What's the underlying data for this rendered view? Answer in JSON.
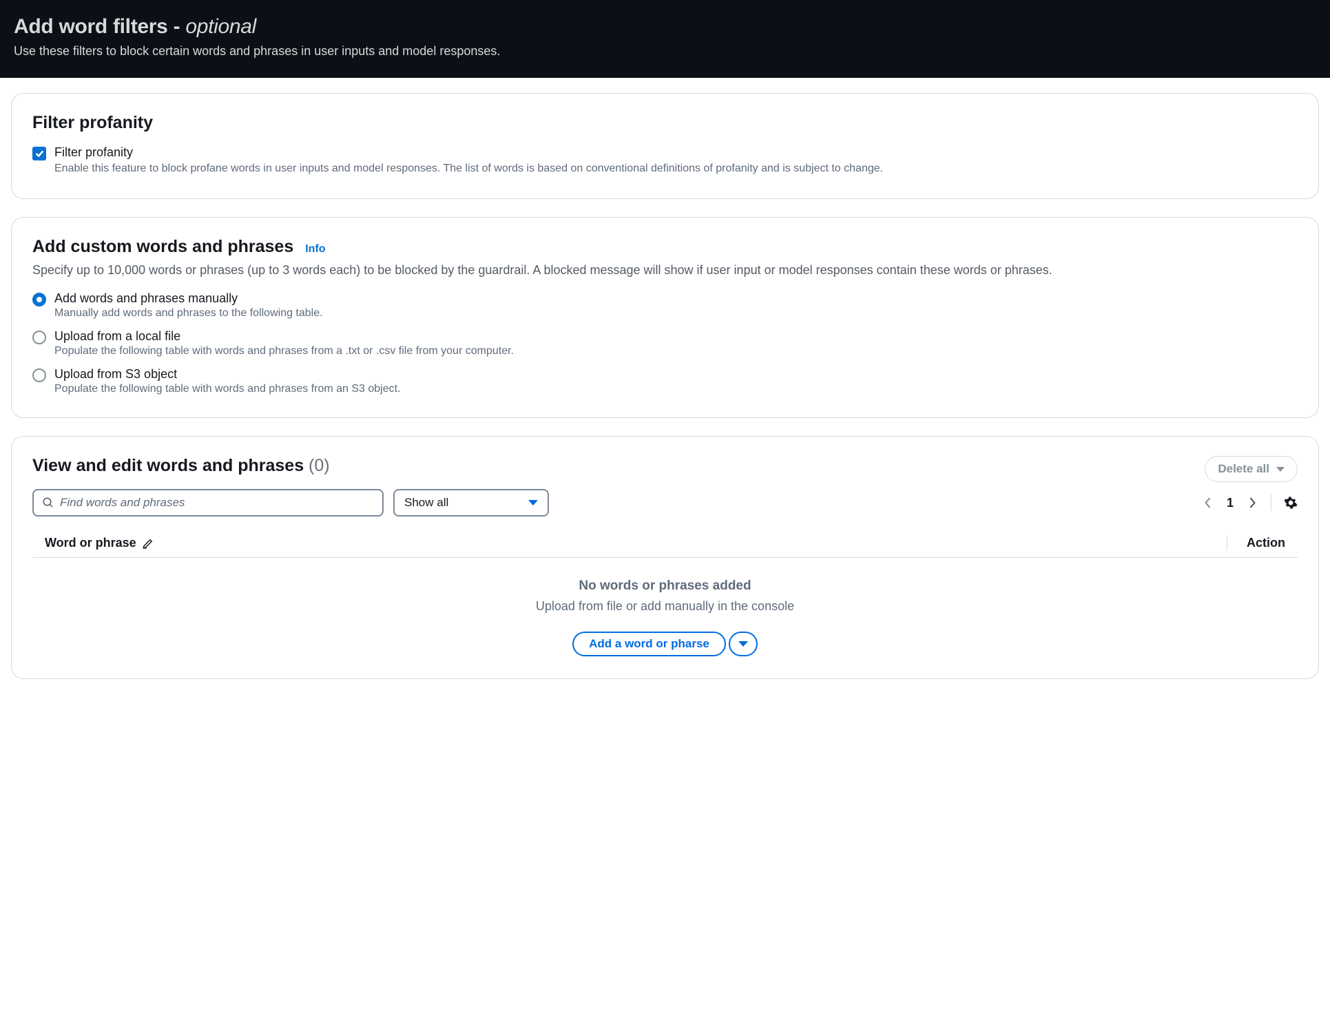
{
  "header": {
    "title_main": "Add word filters -",
    "title_optional": "optional",
    "desc": "Use these filters to block certain words and phrases in user inputs and model responses."
  },
  "profanity": {
    "section_title": "Filter profanity",
    "check_label": "Filter profanity",
    "check_desc": "Enable this feature to block profane words in user inputs and model responses. The list of words is based on conventional definitions of profanity and is subject to change.",
    "checked": true
  },
  "custom": {
    "section_title": "Add custom words and phrases",
    "info_label": "Info",
    "desc": "Specify up to 10,000 words or phrases (up to 3 words each) to be blocked by the guardrail. A blocked message will show if user input or model responses contain these words or phrases.",
    "options": [
      {
        "label": "Add words and phrases manually",
        "desc": "Manually add words and phrases to the following table.",
        "selected": true
      },
      {
        "label": "Upload from a local file",
        "desc": "Populate the following table with words and phrases from a .txt or .csv file from your computer.",
        "selected": false
      },
      {
        "label": "Upload from S3 object",
        "desc": "Populate the following table with words and phrases from an S3 object.",
        "selected": false
      }
    ]
  },
  "view": {
    "section_title": "View and edit words and phrases",
    "count_text": "(0)",
    "delete_all_label": "Delete all",
    "search_placeholder": "Find words and phrases",
    "select_label": "Show all",
    "page_number": "1",
    "col_word": "Word or phrase",
    "col_action": "Action",
    "empty_line1": "No words or phrases added",
    "empty_line2": "Upload from file or add manually in the console",
    "add_button_label": "Add a word or pharse"
  }
}
